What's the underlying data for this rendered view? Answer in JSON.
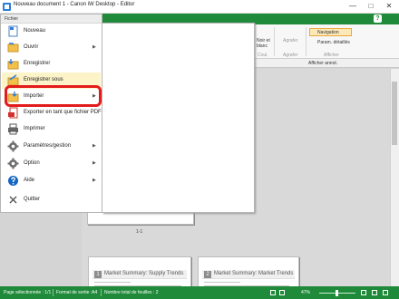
{
  "window": {
    "title": "Nouveau document 1 - Canon iW Desktop - Editor",
    "min_glyph": "—",
    "max_glyph": "□",
    "close_glyph": "✕"
  },
  "ribbon": {
    "help_glyph": "?",
    "noir_et_blanc": "Noir et",
    "blanc": "blanc",
    "coul_group": "Coul.",
    "agrafer": "Agrafer",
    "agrafer_group": "Agrafer",
    "navigation": "Navigation",
    "param_details": "Param. détaillés",
    "afficher_group": "Afficher",
    "afficher_annot": "Afficher annot."
  },
  "file_menu": {
    "title": "Fichier",
    "items": [
      {
        "label": "Nouveau",
        "arrow": ""
      },
      {
        "label": "Ouvrir",
        "arrow": "▶"
      },
      {
        "label": "Enregistrer",
        "arrow": ""
      },
      {
        "label": "Enregistrer sous",
        "arrow": ""
      },
      {
        "label": "Importer",
        "arrow": "▶"
      },
      {
        "label": "Exporter en tant que fichier PDF",
        "arrow": ""
      },
      {
        "label": "Imprimer",
        "arrow": ""
      },
      {
        "label": "Paramètres/gestion",
        "arrow": "▶"
      },
      {
        "label": "Option",
        "arrow": "▶"
      },
      {
        "label": "Aide",
        "arrow": "▶"
      },
      {
        "label": "Quitter",
        "arrow": ""
      }
    ]
  },
  "document": {
    "page_label": "1-1",
    "sheets": [
      {
        "num": "1",
        "title": "Market Summary: Supply Trends"
      },
      {
        "num": "2",
        "title": "Market Summary: Market Trends"
      }
    ]
  },
  "status": {
    "page_selected": "Page sélectionnée : 1/1",
    "paper_format": "Format de sortie :A4",
    "sheet_count": "Nombre total de feuilles : 2",
    "zoom": "47%"
  },
  "colors": {
    "accent": "#1f8a3a",
    "highlight_ring": "#e31b1b",
    "selected_item": "#fdf3c8"
  }
}
